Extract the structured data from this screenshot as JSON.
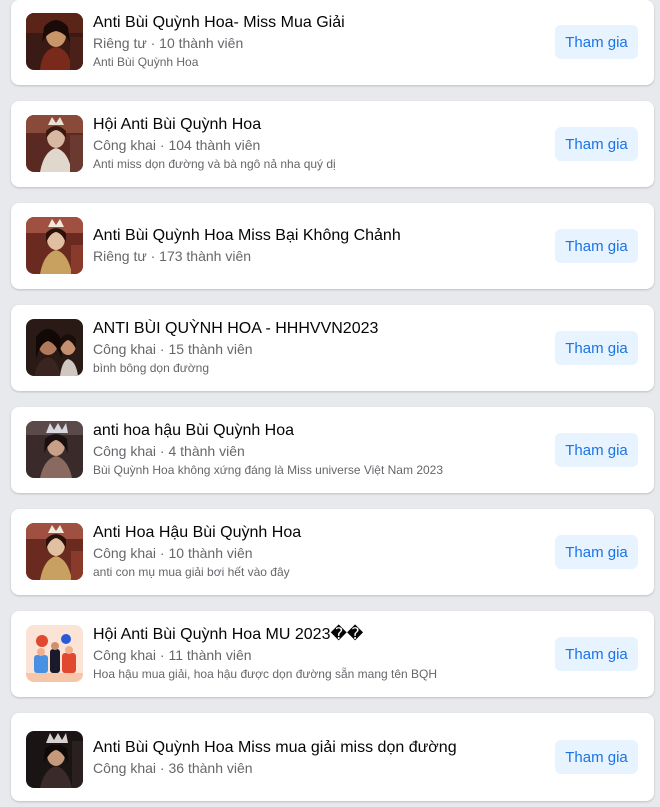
{
  "groups": [
    {
      "title": "Anti Bùi Quỳnh Hoa- Miss Mua Giải",
      "meta": "Riêng tư · 10 thành viên",
      "description": "Anti Bùi Quỳnh Hoa",
      "join_label": "Tham gia",
      "thumb_bg": "#3a1a14",
      "thumb_accent": "#c9956b"
    },
    {
      "title": "Hội Anti Bùi Quỳnh Hoa",
      "meta": "Công khai · 104 thành viên",
      "description": "Anti miss dọn đường và bà ngô nả nha quý dị",
      "join_label": "Tham gia",
      "thumb_bg": "#5a2a22",
      "thumb_accent": "#d8b8a0"
    },
    {
      "title": "Anti Bùi Quỳnh Hoa Miss Bại Không Chảnh",
      "meta": "Riêng tư · 173 thành viên",
      "description": "",
      "join_label": "Tham gia",
      "thumb_bg": "#6a2a20",
      "thumb_accent": "#e0c0a0"
    },
    {
      "title": "ANTI BÙI QUỲNH HOA - HHHVVN2023",
      "meta": "Công khai · 15 thành viên",
      "description": "bình bông dọn đường",
      "join_label": "Tham gia",
      "thumb_bg": "#2a1a16",
      "thumb_accent": "#b07a5a"
    },
    {
      "title": "anti hoa hậu Bùi Quỳnh Hoa",
      "meta": "Công khai · 4 thành viên",
      "description": "Bùi Quỳnh Hoa không xứng đáng là Miss universe Việt Nam 2023",
      "join_label": "Tham gia",
      "thumb_bg": "#3a2a2a",
      "thumb_accent": "#c8a088"
    },
    {
      "title": "Anti Hoa Hậu Bùi Quỳnh Hoa",
      "meta": "Công khai · 10 thành viên",
      "description": "anti con mụ mua giải bơi hết vào đây",
      "join_label": "Tham gia",
      "thumb_bg": "#6a2a20",
      "thumb_accent": "#e0c0a0"
    },
    {
      "title": "Hội Anti Bùi Quỳnh Hoa MU 2023��",
      "meta": "Công khai · 11 thành viên",
      "description": "Hoa hậu mua giải, hoa hậu được dọn đường sẵn mang tên BQH",
      "join_label": "Tham gia",
      "thumb_bg": "#fbe3d6",
      "thumb_accent": "#e2472f"
    },
    {
      "title": "Anti Bùi Quỳnh Hoa Miss mua giải miss dọn đường",
      "meta": "Công khai · 36 thành viên",
      "description": "",
      "join_label": "Tham gia",
      "thumb_bg": "#1a1414",
      "thumb_accent": "#c49a7a"
    }
  ]
}
